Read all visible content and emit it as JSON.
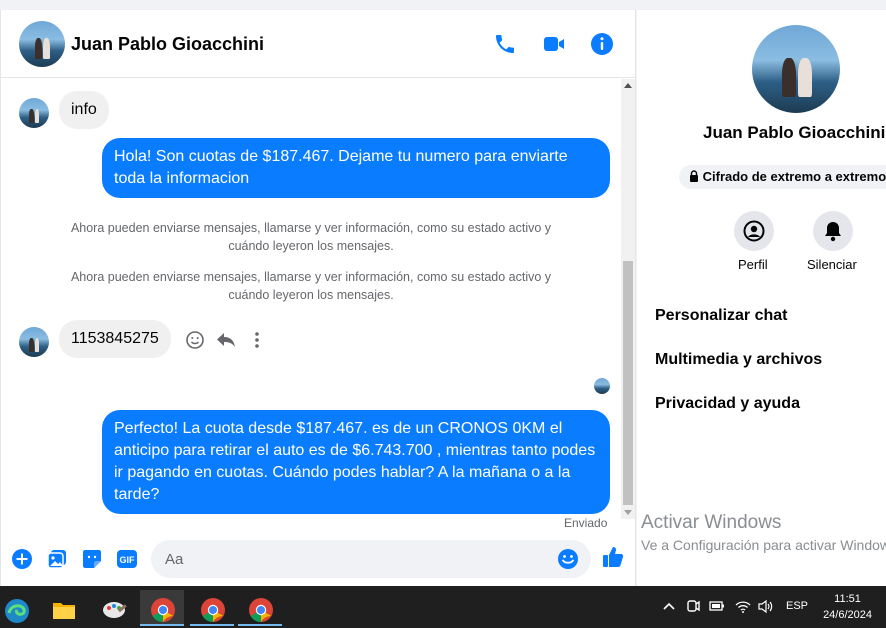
{
  "header": {
    "contact_name": "Juan Pablo Gioacchini"
  },
  "messages": {
    "m1": "info",
    "m2": "Hola! Son cuotas de $187.467. Dejame tu numero para enviarte toda la informacion",
    "sys1": "Ahora pueden enviarse mensajes, llamarse y ver información, como su estado activo y cuándo leyeron los mensajes.",
    "sys2": "Ahora pueden enviarse mensajes, llamarse y ver información, como su estado activo y cuándo leyeron los mensajes.",
    "m3": "1153845275",
    "m4": "Perfecto! La cuota desde $187.467. es de un CRONOS 0KM el anticipo para retirar el auto es de $6.743.700 , mientras tanto podes ir pagando en cuotas. Cuándo podes hablar? A la mañana o a la tarde?",
    "status": "Enviado"
  },
  "composer": {
    "placeholder": "Aa"
  },
  "sidebar": {
    "name": "Juan Pablo Gioacchini",
    "encryption": "Cifrado de extremo a extremo",
    "profile_label": "Perfil",
    "mute_label": "Silenciar",
    "menu": [
      "Personalizar chat",
      "Multimedia y archivos",
      "Privacidad y ayuda"
    ]
  },
  "watermark": {
    "title": "Activar Windows",
    "subtitle": "Ve a Configuración para activar Windows."
  },
  "taskbar": {
    "lang": "ESP",
    "time": "11:51",
    "date": "24/6/2024"
  },
  "colors": {
    "accent": "#0a7cff",
    "taskbar": "#1f1f1f"
  }
}
